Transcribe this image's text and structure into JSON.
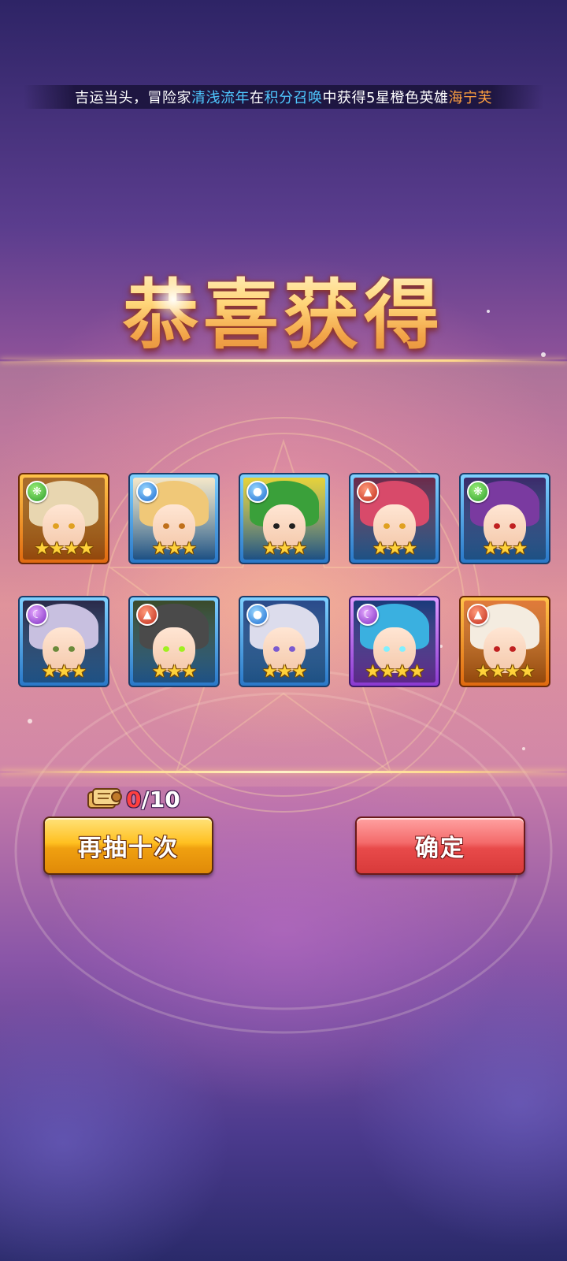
{
  "broadcast": {
    "prefix": "吉运当头，冒险家",
    "player_name": "清浅流年",
    "mid1": "在",
    "pool_name": "积分召唤",
    "mid2": "中获得5星橙色英雄",
    "hero_name": "海宁芙"
  },
  "title": "恭喜获得",
  "heroes": [
    {
      "element": "wind",
      "element_icon": "wind-icon",
      "frame": "orange",
      "stars": 4,
      "stars_text": "★★★★",
      "hair": "#e8d6b0",
      "eyes": "#e0a020",
      "bg": "#a86a2a"
    },
    {
      "element": "water",
      "element_icon": "water-drop-icon",
      "frame": "blue",
      "stars": 3,
      "stars_text": "★★★",
      "hair": "#f0c878",
      "eyes": "#c0701a",
      "bg": "#f4e6c8"
    },
    {
      "element": "water",
      "element_icon": "water-drop-icon",
      "frame": "blue",
      "stars": 3,
      "stars_text": "★★★",
      "hair": "#3aa03a",
      "eyes": "#202020",
      "bg": "#e6d23a"
    },
    {
      "element": "fire",
      "element_icon": "fire-icon",
      "frame": "blue",
      "stars": 3,
      "stars_text": "★★★",
      "hair": "#d84a6a",
      "eyes": "#e0a020",
      "bg": "#6a2a4a"
    },
    {
      "element": "wind",
      "element_icon": "wind-icon",
      "frame": "blue",
      "stars": 3,
      "stars_text": "★★★",
      "hair": "#7a3aa0",
      "eyes": "#c02020",
      "bg": "#3a2a6a"
    },
    {
      "element": "dark",
      "element_icon": "moon-icon",
      "frame": "blue",
      "stars": 3,
      "stars_text": "★★★",
      "hair": "#c8c0e0",
      "eyes": "#6a8a3a",
      "bg": "#2a2a4a"
    },
    {
      "element": "fire",
      "element_icon": "fire-icon",
      "frame": "blue",
      "stars": 3,
      "stars_text": "★★★",
      "hair": "#4a4a4a",
      "eyes": "#a0f020",
      "bg": "#3a4a2a"
    },
    {
      "element": "water",
      "element_icon": "water-drop-icon",
      "frame": "blue",
      "stars": 3,
      "stars_text": "★★★",
      "hair": "#dcdcec",
      "eyes": "#7a5ad0",
      "bg": "#2a4a8a"
    },
    {
      "element": "dark",
      "element_icon": "moon-icon",
      "frame": "purple",
      "stars": 4,
      "stars_text": "★★★★",
      "hair": "#3ab0e0",
      "eyes": "#80f0ff",
      "bg": "#1a3a7a"
    },
    {
      "element": "fire",
      "element_icon": "fire-icon",
      "frame": "orange",
      "stars": 4,
      "stars_text": "★★★★",
      "hair": "#f4ece0",
      "eyes": "#c02020",
      "bg": "#e07a3a"
    }
  ],
  "counter": {
    "icon": "ticket-scroll-icon",
    "used": "0",
    "total": "/10"
  },
  "buttons": {
    "draw_again": "再抽十次",
    "confirm": "确定"
  }
}
